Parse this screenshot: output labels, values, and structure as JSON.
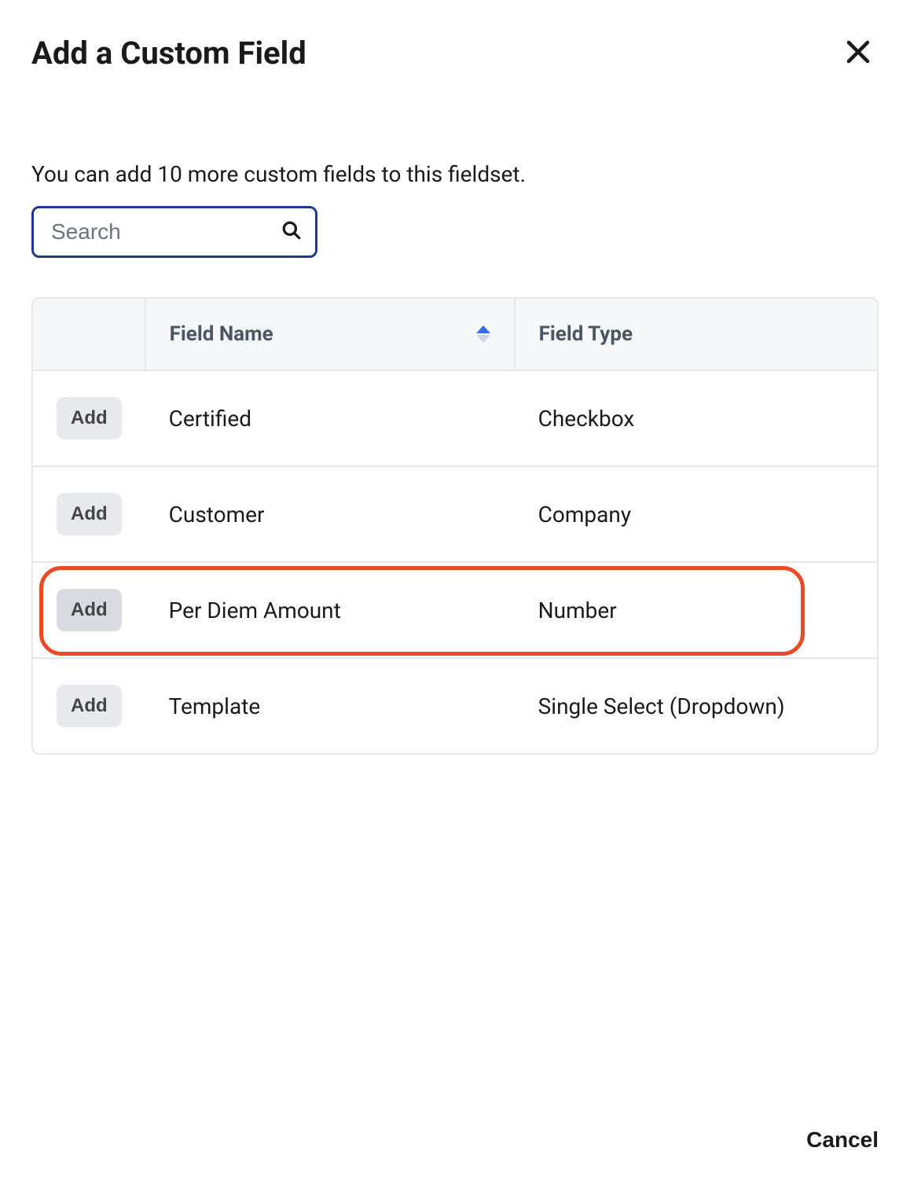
{
  "header": {
    "title": "Add a Custom Field"
  },
  "subtitle": "You can add 10 more custom fields to this fieldset.",
  "search": {
    "placeholder": "Search",
    "value": ""
  },
  "table": {
    "columns": {
      "name": "Field Name",
      "type": "Field Type"
    },
    "add_label": "Add",
    "rows": [
      {
        "name": "Certified",
        "type": "Checkbox",
        "highlighted": false,
        "hover": false
      },
      {
        "name": "Customer",
        "type": "Company",
        "highlighted": false,
        "hover": false
      },
      {
        "name": "Per Diem Amount",
        "type": "Number",
        "highlighted": true,
        "hover": true
      },
      {
        "name": "Template",
        "type": "Single Select (Dropdown)",
        "highlighted": false,
        "hover": false
      }
    ]
  },
  "footer": {
    "cancel_label": "Cancel"
  }
}
